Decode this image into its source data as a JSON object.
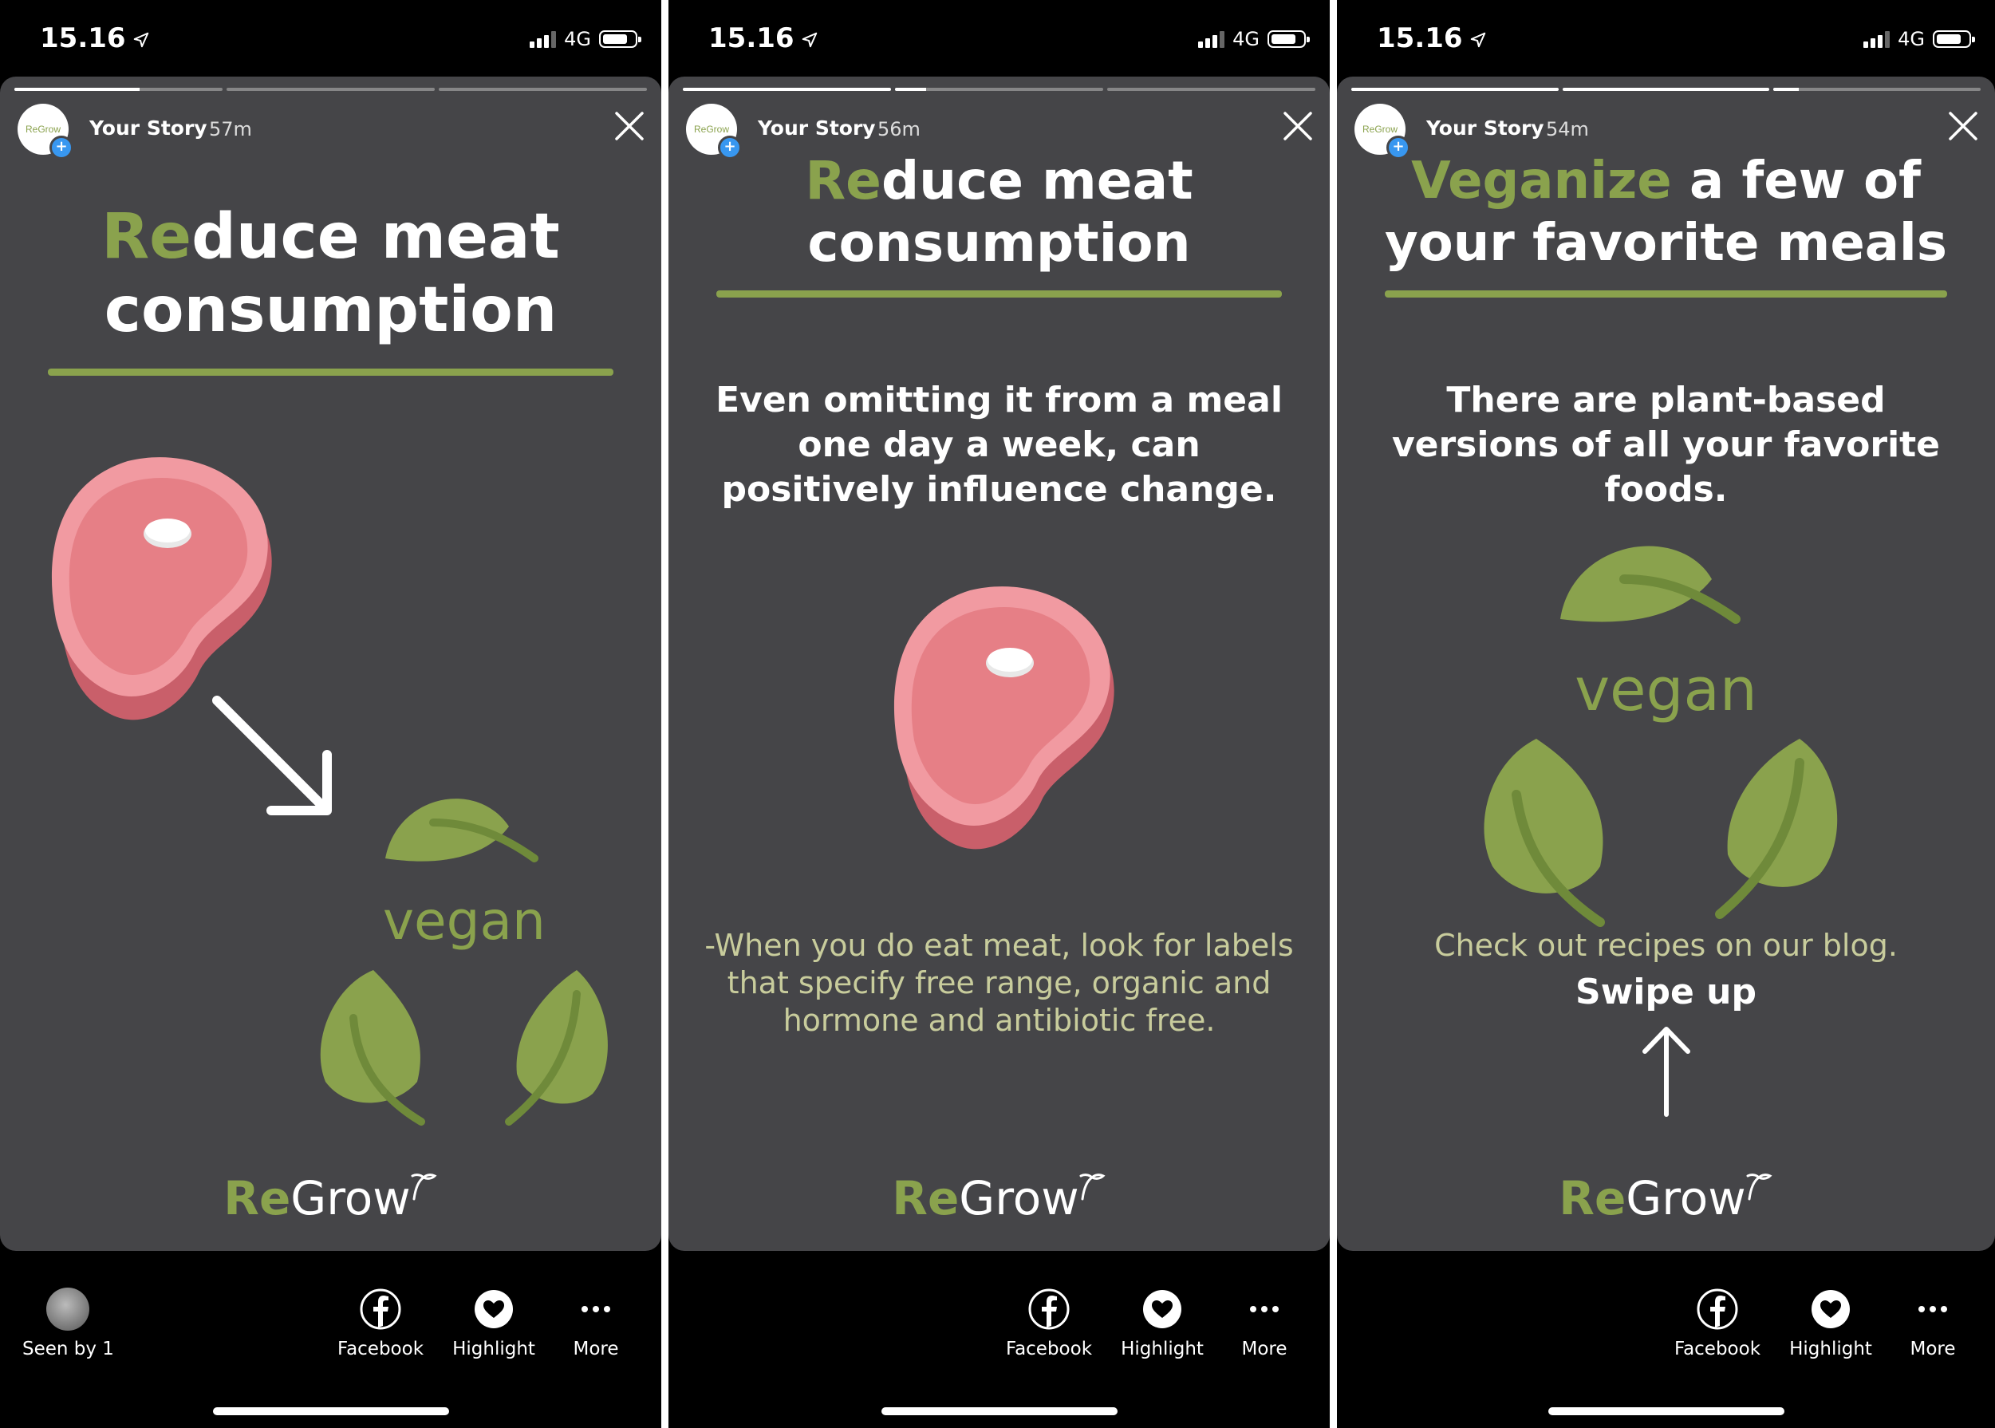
{
  "colors": {
    "accent": "#8aa24d",
    "card_bg": "#454548",
    "note_text": "#c8cc9c",
    "meat_pink": "#e67f86"
  },
  "status": {
    "time": "15.16",
    "network": "4G"
  },
  "story": {
    "name": "Your Story",
    "avatar_text": "ReGrow"
  },
  "logo": {
    "re": "Re",
    "grow": "Grow"
  },
  "actions": {
    "facebook": "Facebook",
    "highlight": "Highlight",
    "more": "More"
  },
  "screens": [
    {
      "time_ago": "57m",
      "progress": [
        1,
        0,
        0
      ],
      "title_accent": "Re",
      "title_line1_rest": "duce meat",
      "title_line2": "consumption",
      "vegan_label": "vegan",
      "seen_label": "Seen by 1"
    },
    {
      "time_ago": "56m",
      "progress": [
        1,
        1,
        0
      ],
      "title_accent": "Re",
      "title_line1_rest": "duce meat",
      "title_line2": "consumption",
      "body": "Even omitting it from a meal one day a week, can positively influence change.",
      "note": "-When you do eat meat, look for labels that specify free range, organic and hormone and antibiotic free."
    },
    {
      "time_ago": "54m",
      "progress": [
        1,
        1,
        0.5
      ],
      "title_accent": "Veganize",
      "title_line1_rest": " a few of",
      "title_line2": "your favorite meals",
      "body": "There are plant-based versions of all your favorite foods.",
      "vegan_label": "vegan",
      "note": "Check out recipes on our blog.",
      "cta": "Swipe up"
    }
  ]
}
